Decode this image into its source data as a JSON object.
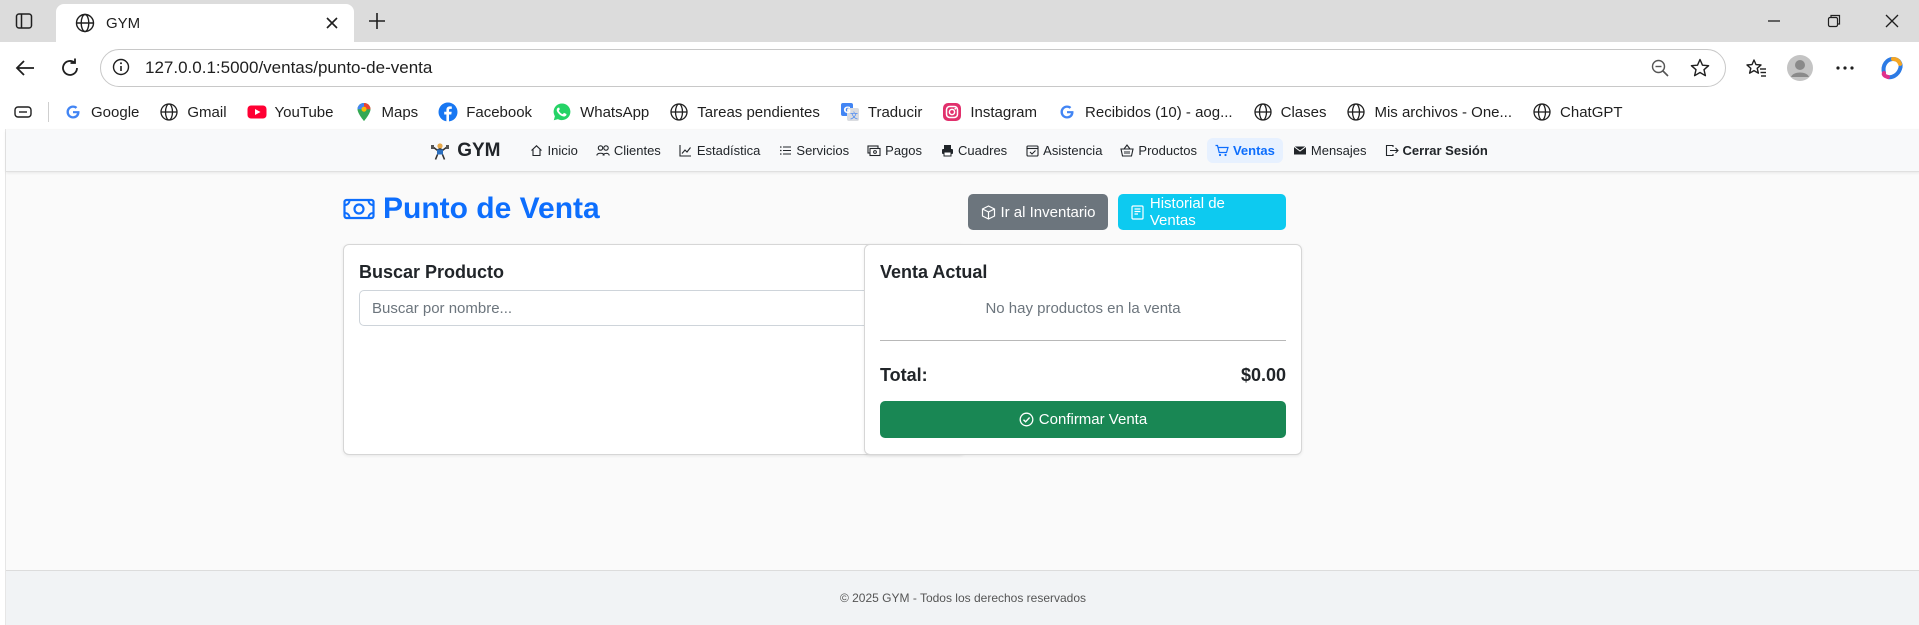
{
  "browser": {
    "tab_title": "GYM",
    "url": "127.0.0.1:5000/ventas/punto-de-venta",
    "bookmarks": [
      {
        "label": "Google",
        "icon": "google-icon"
      },
      {
        "label": "Gmail",
        "icon": "globe-icon"
      },
      {
        "label": "YouTube",
        "icon": "youtube-icon"
      },
      {
        "label": "Maps",
        "icon": "maps-icon"
      },
      {
        "label": "Facebook",
        "icon": "facebook-icon"
      },
      {
        "label": "WhatsApp",
        "icon": "whatsapp-icon"
      },
      {
        "label": "Tareas pendientes",
        "icon": "globe-icon"
      },
      {
        "label": "Traducir",
        "icon": "translate-icon"
      },
      {
        "label": "Instagram",
        "icon": "instagram-icon"
      },
      {
        "label": "Recibidos (10) - aog...",
        "icon": "google-icon"
      },
      {
        "label": "Clases",
        "icon": "globe-icon"
      },
      {
        "label": "Mis archivos - One...",
        "icon": "globe-icon"
      },
      {
        "label": "ChatGPT",
        "icon": "globe-icon"
      }
    ]
  },
  "navbar": {
    "brand": "GYM",
    "links": [
      {
        "label": "Inicio",
        "icon": "house-icon"
      },
      {
        "label": "Clientes",
        "icon": "people-icon"
      },
      {
        "label": "Estadística",
        "icon": "chart-icon"
      },
      {
        "label": "Servicios",
        "icon": "list-icon"
      },
      {
        "label": "Pagos",
        "icon": "cash-icon"
      },
      {
        "label": "Cuadres",
        "icon": "printer-icon"
      },
      {
        "label": "Asistencia",
        "icon": "calendar-check-icon"
      },
      {
        "label": "Productos",
        "icon": "basket-icon"
      },
      {
        "label": "Ventas",
        "icon": "cart-icon"
      },
      {
        "label": "Mensajes",
        "icon": "envelope-icon"
      },
      {
        "label": "Cerrar Sesión",
        "icon": "logout-icon"
      }
    ],
    "active": "Ventas"
  },
  "main": {
    "title": "Punto de Venta",
    "inventory_button": "Ir al Inventario",
    "history_button": "Historial de Ventas",
    "search_card": {
      "heading": "Buscar Producto",
      "placeholder": "Buscar por nombre..."
    },
    "sale_card": {
      "heading": "Venta Actual",
      "empty_message": "No hay productos en la venta",
      "total_label": "Total:",
      "total_value": "$0.00",
      "confirm_button": "Confirmar Venta"
    }
  },
  "footer": {
    "text": "© 2025 GYM - Todos los derechos reservados"
  },
  "colors": {
    "primary": "#0d6efd",
    "secondary": "#6c757d",
    "info": "#0dcaf0",
    "success": "#198754"
  }
}
